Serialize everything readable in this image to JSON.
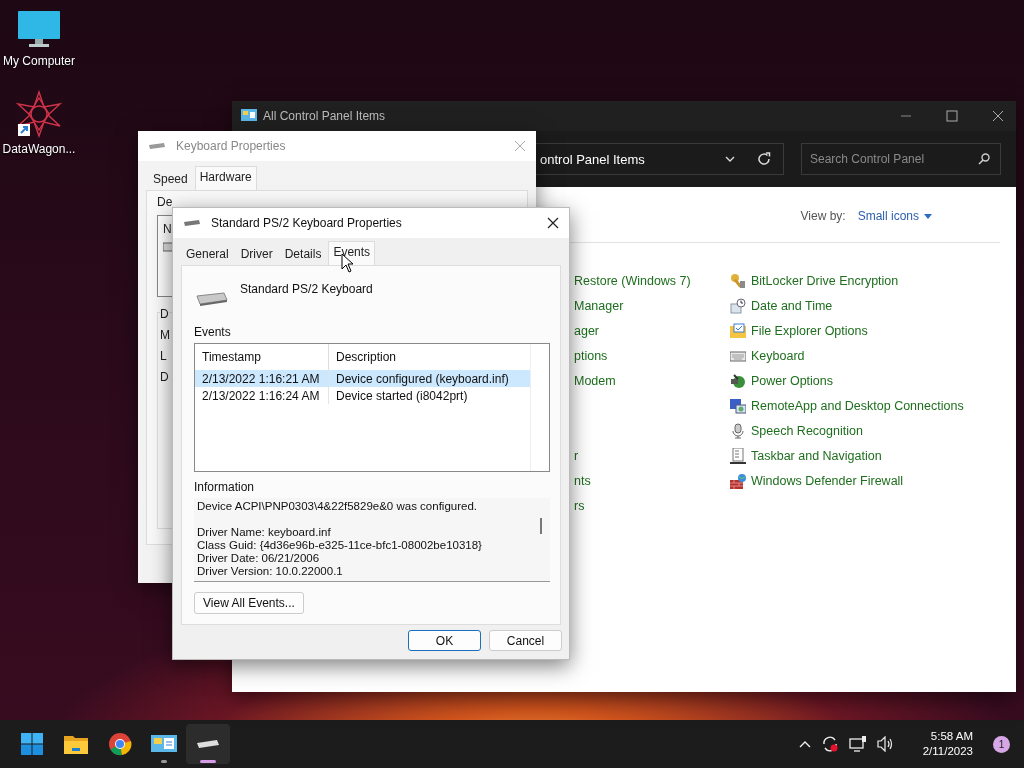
{
  "desktop_icons": [
    {
      "label": "My Computer",
      "kind": "computer"
    },
    {
      "label": "DataWagon...",
      "kind": "shortcut"
    }
  ],
  "control_panel": {
    "title": "All Control Panel Items",
    "address": "ontrol Panel Items",
    "search": {
      "placeholder": "Search Control Panel"
    },
    "view_by": {
      "label": "View by:",
      "value": "Small icons"
    },
    "rows": [
      {
        "left": "Restore (Windows 7)",
        "right": {
          "label": "BitLocker Drive Encryption",
          "kind": "bitlocker"
        }
      },
      {
        "left": "Manager",
        "right": {
          "label": "Date and Time",
          "kind": "clock"
        }
      },
      {
        "left": "ager",
        "right": {
          "label": "File Explorer Options",
          "kind": "folder"
        }
      },
      {
        "left": "ptions",
        "right": {
          "label": "Keyboard",
          "kind": "keyboard"
        }
      },
      {
        "left": "Modem",
        "right": {
          "label": "Power Options",
          "kind": "power"
        }
      },
      {
        "right": {
          "label": "RemoteApp and Desktop Connections",
          "kind": "remote"
        }
      },
      {
        "right": {
          "label": "Speech Recognition",
          "kind": "mic"
        }
      },
      {
        "left": "r",
        "right": {
          "label": "Taskbar and Navigation",
          "kind": "taskbar"
        }
      },
      {
        "left": "nts",
        "right": {
          "label": "Windows Defender Firewall",
          "kind": "firewall"
        }
      },
      {
        "left": "rs"
      }
    ]
  },
  "keyboard_properties": {
    "title": "Keyboard Properties",
    "tabs": [
      {
        "label": "Speed",
        "selected": false
      },
      {
        "label": "Hardware",
        "selected": true
      }
    ],
    "devices_label": "De",
    "list_column": "N",
    "group_label": "D",
    "group_lines": [
      "M",
      "L",
      "D"
    ]
  },
  "device_dialog": {
    "title": "Standard PS/2 Keyboard Properties",
    "tabs": [
      {
        "label": "General",
        "selected": false
      },
      {
        "label": "Driver",
        "selected": false
      },
      {
        "label": "Details",
        "selected": false
      },
      {
        "label": "Events",
        "selected": true
      }
    ],
    "device_name": "Standard PS/2 Keyboard",
    "events_label": "Events",
    "columns": [
      "Timestamp",
      "Description"
    ],
    "events": [
      {
        "timestamp": "2/13/2022 1:16:21 AM",
        "description": "Device configured (keyboard.inf)",
        "selected": true
      },
      {
        "timestamp": "2/13/2022 1:16:24 AM",
        "description": "Device started (i8042prt)",
        "selected": false
      }
    ],
    "information_label": "Information",
    "information": {
      "summary": "Device ACPI\\PNP0303\\4&22f5829e&0 was configured.",
      "details": [
        "Driver Name: keyboard.inf",
        "Class Guid: {4d36e96b-e325-11ce-bfc1-08002be10318}",
        "Driver Date: 06/21/2006",
        "Driver Version: 10.0.22000.1"
      ]
    },
    "view_all_button": "View All Events...",
    "buttons": [
      {
        "label": "OK",
        "default": true
      },
      {
        "label": "Cancel",
        "default": false
      }
    ]
  },
  "taskbar": {
    "apps": [
      {
        "kind": "start",
        "running": false,
        "active": false
      },
      {
        "kind": "folder",
        "running": false,
        "active": false
      },
      {
        "kind": "browser",
        "running": false,
        "active": false
      },
      {
        "kind": "control-panel",
        "running": true,
        "active": false
      },
      {
        "kind": "keyboard",
        "running": true,
        "active": true
      }
    ],
    "time": "5:58 AM",
    "date": "2/11/2023",
    "notifications": "1"
  }
}
